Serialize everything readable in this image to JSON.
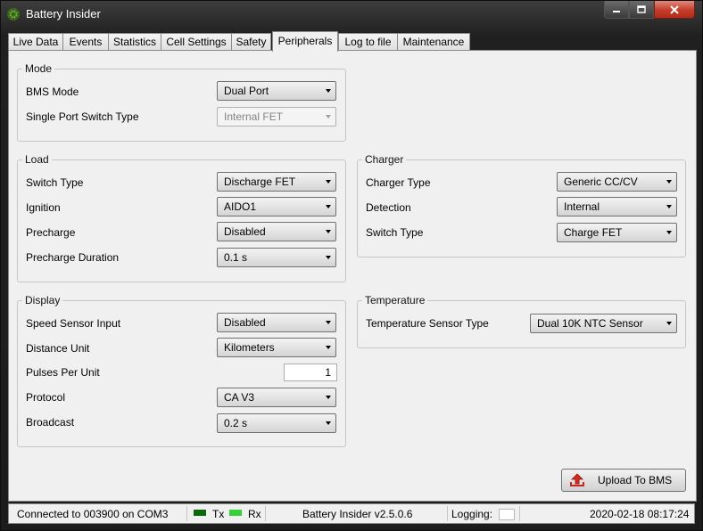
{
  "window": {
    "title": "Battery Insider"
  },
  "tabs": [
    {
      "label": "Live Data"
    },
    {
      "label": "Events"
    },
    {
      "label": "Statistics"
    },
    {
      "label": "Cell Settings"
    },
    {
      "label": "Safety"
    },
    {
      "label": "Peripherals",
      "active": true
    },
    {
      "label": "Log to file"
    },
    {
      "label": "Maintenance"
    }
  ],
  "mode": {
    "legend": "Mode",
    "bms_mode_label": "BMS Mode",
    "bms_mode_value": "Dual Port",
    "single_port_label": "Single Port Switch Type",
    "single_port_value": "Internal FET"
  },
  "load": {
    "legend": "Load",
    "switch_type_label": "Switch Type",
    "switch_type_value": "Discharge FET",
    "ignition_label": "Ignition",
    "ignition_value": "AIDO1",
    "precharge_label": "Precharge",
    "precharge_value": "Disabled",
    "precharge_duration_label": "Precharge Duration",
    "precharge_duration_value": "0.1 s"
  },
  "charger": {
    "legend": "Charger",
    "charger_type_label": "Charger Type",
    "charger_type_value": "Generic CC/CV",
    "detection_label": "Detection",
    "detection_value": "Internal",
    "switch_type_label": "Switch Type",
    "switch_type_value": "Charge FET"
  },
  "display": {
    "legend": "Display",
    "speed_sensor_label": "Speed Sensor Input",
    "speed_sensor_value": "Disabled",
    "distance_unit_label": "Distance Unit",
    "distance_unit_value": "Kilometers",
    "pulses_label": "Pulses Per Unit",
    "pulses_value": "1",
    "protocol_label": "Protocol",
    "protocol_value": "CA V3",
    "broadcast_label": "Broadcast",
    "broadcast_value": "0.2 s"
  },
  "temperature": {
    "legend": "Temperature",
    "sensor_type_label": "Temperature Sensor Type",
    "sensor_type_value": "Dual 10K NTC Sensor"
  },
  "upload_button": {
    "label": "Upload To BMS"
  },
  "status": {
    "connection": "Connected to 003900 on COM3",
    "tx_label": "Tx",
    "rx_label": "Rx",
    "tx_color": "#0a6a0a",
    "rx_color": "#38d038",
    "version": "Battery Insider v2.5.0.6",
    "logging_label": "Logging:",
    "datetime": "2020-02-18 08:17:24"
  }
}
